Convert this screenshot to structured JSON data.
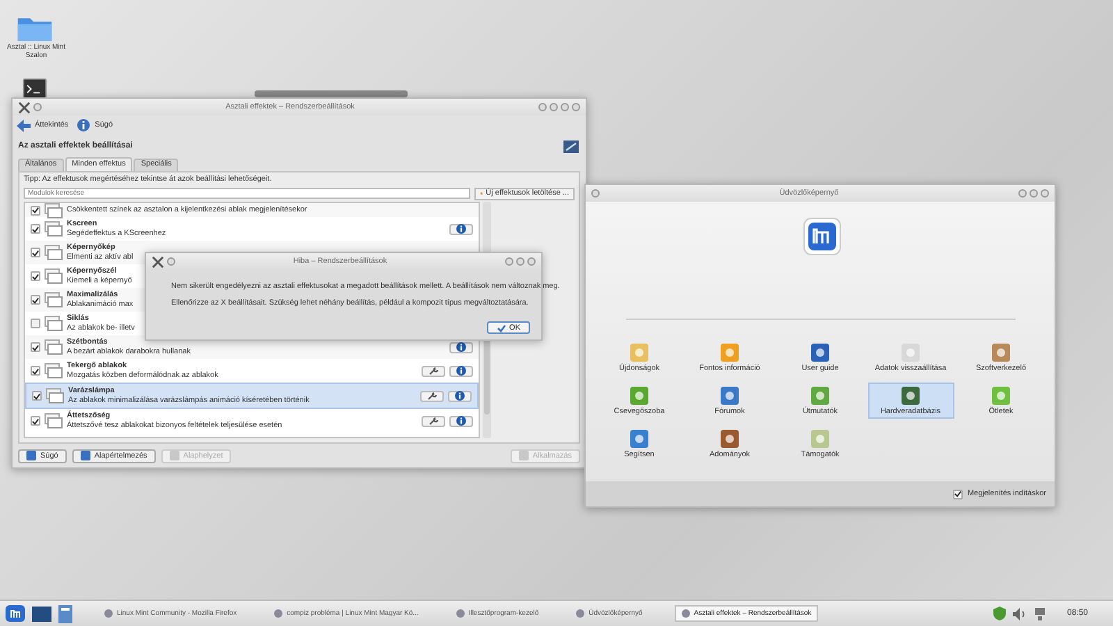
{
  "desktop": {
    "folder_label": "Asztal :: Linux Mint Szalon"
  },
  "effects_window": {
    "title": "Asztali effektek – Rendszerbeállítások",
    "toolbar": [
      {
        "label": "Áttekintés"
      },
      {
        "label": "Súgó"
      }
    ],
    "heading": "Az asztali effektek beállításai",
    "tabs": [
      {
        "label": "Általános",
        "selected": false
      },
      {
        "label": "Minden effektus",
        "selected": true
      },
      {
        "label": "Speciális",
        "selected": false
      }
    ],
    "tip": "Tipp: Az effektusok megértéséhez tekintse át azok beállítási lehetőségeit.",
    "search": {
      "placeholder": "Modulok keresése"
    },
    "download_button": "Új effektusok letöltése ...",
    "rows": [
      {
        "description": "Csökkentett színek az asztalon a kijelentkezési ablak megjelenítésekor",
        "checked": true,
        "selected": false,
        "config": false,
        "info": false
      },
      {
        "title": "Kscreen",
        "description": "Segédeffektus a KScreenhez",
        "checked": true,
        "selected": false,
        "config": false,
        "info": true
      },
      {
        "title": "Képernyőkép",
        "description": "Elmenti az aktív abl",
        "checked": true,
        "selected": false,
        "config": false,
        "info": false
      },
      {
        "title": "Képernyőszél",
        "description": "Kiemeli a képernyő",
        "checked": true,
        "selected": false,
        "config": false,
        "info": false
      },
      {
        "title": "Maximalizálás",
        "description": "Ablakanimáció max",
        "checked": true,
        "selected": false,
        "config": false,
        "info": false
      },
      {
        "title": "Siklás",
        "description": "Az ablakok be- illetv",
        "checked": false,
        "selected": false,
        "config": false,
        "info": false
      },
      {
        "title": "Szétbontás",
        "description": "A bezárt ablakok darabokra hullanak",
        "checked": true,
        "selected": false,
        "config": false,
        "info": true
      },
      {
        "title": "Tekergő ablakok",
        "description": "Mozgatás közben deformálódnak az ablakok",
        "checked": true,
        "selected": false,
        "config": true,
        "info": true
      },
      {
        "title": "Varázslámpa",
        "description": "Az ablakok minimalizálása varázslámpás animáció kíséretében történik",
        "checked": true,
        "selected": true,
        "config": true,
        "info": true
      },
      {
        "title": "Áttetszőség",
        "description": "Áttetszővé tesz ablakokat bizonyos feltételek teljesülése esetén",
        "checked": true,
        "selected": false,
        "config": true,
        "info": true
      }
    ],
    "footer_buttons": [
      {
        "label": "Súgó",
        "disabled": false
      },
      {
        "label": "Alapértelmezés",
        "disabled": false
      },
      {
        "label": "Alaphelyzet",
        "disabled": true
      },
      {
        "label": "Alkalmazás",
        "disabled": true
      }
    ]
  },
  "error_dialog": {
    "title": "Hiba – Rendszerbeállítások",
    "messages": [
      "Nem sikerült engedélyezni az asztali effektusokat a megadott beállítások mellett. A beállítások nem változnak meg.",
      "Ellenőrizze az X beállításait. Szükség lehet néhány beállítás, például a kompozit típus megváltoztatására."
    ],
    "ok_button": "OK"
  },
  "welcome_window": {
    "title": "Üdvözlőképernyő",
    "items": [
      {
        "label": "Újdonságok",
        "selected": false
      },
      {
        "label": "Fontos információ",
        "selected": false
      },
      {
        "label": "User guide",
        "selected": false
      },
      {
        "label": "Adatok visszaállítása",
        "selected": false
      },
      {
        "label": "Szoftverkezelő",
        "selected": false
      },
      {
        "label": "Csevegőszoba",
        "selected": false
      },
      {
        "label": "Fórumok",
        "selected": false
      },
      {
        "label": "Útmutatók",
        "selected": false
      },
      {
        "label": "Hardveradatbázis",
        "selected": true
      },
      {
        "label": "Ötletek",
        "selected": false
      },
      {
        "label": "Segítsen",
        "selected": false
      },
      {
        "label": "Adományok",
        "selected": false
      },
      {
        "label": "Támogatók",
        "selected": false
      }
    ],
    "show_on_startup": {
      "label": "Megjelenítés indításkor",
      "checked": true
    }
  },
  "taskbar": {
    "tasks": [
      {
        "label": "Linux Mint Community - Mozilla Firefox",
        "selected": false
      },
      {
        "label": "compiz probléma | Linux Mint Magyar Kö...",
        "selected": false
      },
      {
        "label": "Illesztőprogram-kezelő",
        "selected": false
      },
      {
        "label": "Üdvözlőképernyő",
        "selected": false
      },
      {
        "label": "Asztali effektek – Rendszerbeállítások",
        "selected": true
      }
    ],
    "clock": "08:50"
  }
}
